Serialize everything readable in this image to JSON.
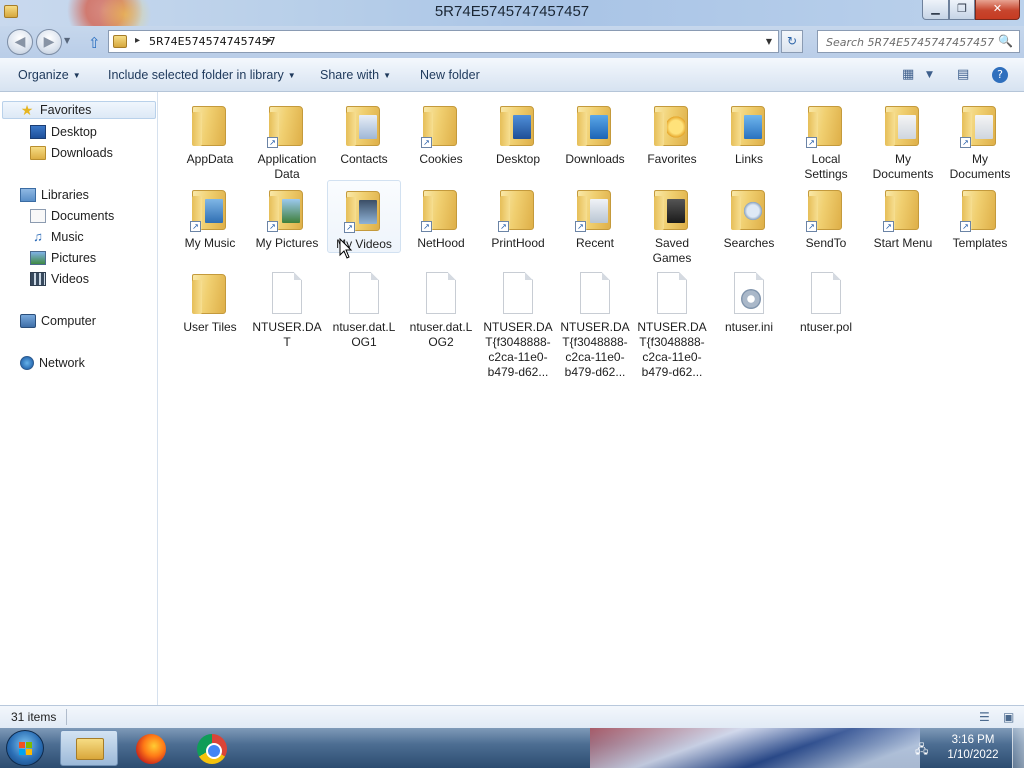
{
  "window": {
    "title": "5R74E5745747457457"
  },
  "address": {
    "path": "5R74E5745747457457",
    "search_placeholder": "Search 5R74E5745747457457"
  },
  "commands": {
    "organize": "Organize",
    "include": "Include selected folder in library",
    "share": "Share with",
    "new_folder": "New folder"
  },
  "nav": {
    "favorites": "Favorites",
    "desktop": "Desktop",
    "downloads": "Downloads",
    "libraries": "Libraries",
    "documents": "Documents",
    "music": "Music",
    "pictures": "Pictures",
    "videos": "Videos",
    "computer": "Computer",
    "network": "Network"
  },
  "items": [
    {
      "label": "AppData",
      "kind": "folder"
    },
    {
      "label": "Application Data",
      "kind": "folder-shortcut"
    },
    {
      "label": "Contacts",
      "kind": "folder"
    },
    {
      "label": "Cookies",
      "kind": "folder-shortcut"
    },
    {
      "label": "Desktop",
      "kind": "folder"
    },
    {
      "label": "Downloads",
      "kind": "folder"
    },
    {
      "label": "Favorites",
      "kind": "folder"
    },
    {
      "label": "Links",
      "kind": "folder"
    },
    {
      "label": "Local Settings",
      "kind": "folder-shortcut"
    },
    {
      "label": "My Documents",
      "kind": "folder"
    },
    {
      "label": "My Documents",
      "kind": "folder-shortcut"
    },
    {
      "label": "My Music",
      "kind": "folder-shortcut"
    },
    {
      "label": "My Pictures",
      "kind": "folder-shortcut"
    },
    {
      "label": "My Videos",
      "kind": "folder-shortcut"
    },
    {
      "label": "NetHood",
      "kind": "folder-shortcut"
    },
    {
      "label": "PrintHood",
      "kind": "folder-shortcut"
    },
    {
      "label": "Recent",
      "kind": "folder-shortcut"
    },
    {
      "label": "Saved Games",
      "kind": "folder"
    },
    {
      "label": "Searches",
      "kind": "folder"
    },
    {
      "label": "SendTo",
      "kind": "folder-shortcut"
    },
    {
      "label": "Start Menu",
      "kind": "folder-shortcut"
    },
    {
      "label": "Templates",
      "kind": "folder-shortcut"
    },
    {
      "label": "User Tiles",
      "kind": "folder"
    },
    {
      "label": "NTUSER.DAT",
      "kind": "file"
    },
    {
      "label": "ntuser.dat.LOG1",
      "kind": "file"
    },
    {
      "label": "ntuser.dat.LOG2",
      "kind": "file"
    },
    {
      "label": "NTUSER.DAT{f3048888-c2ca-11e0-b479-d62...",
      "kind": "file"
    },
    {
      "label": "NTUSER.DAT{f3048888-c2ca-11e0-b479-d62...",
      "kind": "file"
    },
    {
      "label": "NTUSER.DAT{f3048888-c2ca-11e0-b479-d62...",
      "kind": "file"
    },
    {
      "label": "ntuser.ini",
      "kind": "ini"
    },
    {
      "label": "ntuser.pol",
      "kind": "file"
    }
  ],
  "status": {
    "count": "31 items"
  },
  "taskbar": {
    "time": "3:16 PM",
    "date": "1/10/2022"
  }
}
